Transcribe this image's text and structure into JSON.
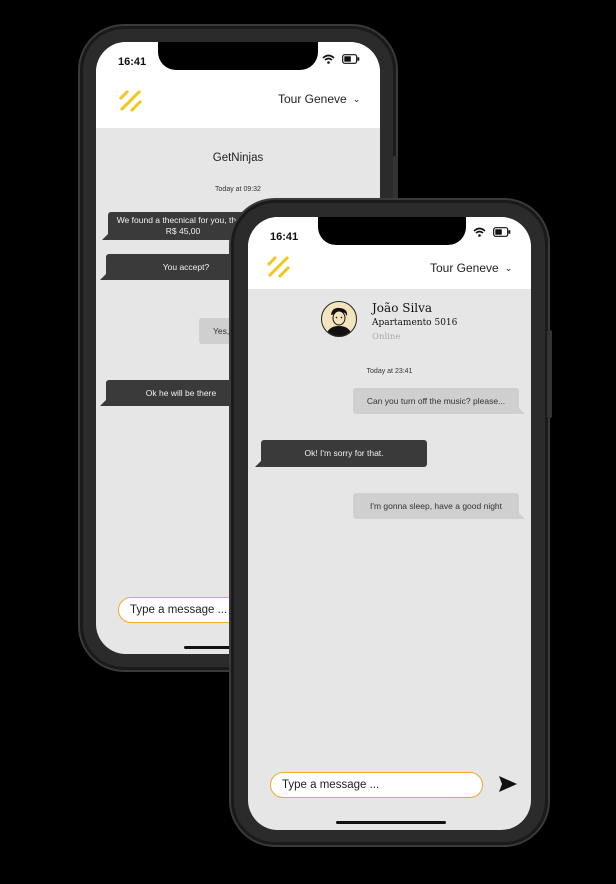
{
  "back_phone": {
    "status_time": "16:41",
    "header": {
      "location": "Tour Geneve"
    },
    "chat_title": "GetNinjas",
    "timestamp": "Today at 09:32",
    "messages": [
      {
        "text": "We found a thecnical for you, the is R$ 45,00",
        "from": "them"
      },
      {
        "text": "You accept?",
        "from": "them"
      },
      {
        "text": "Yes,",
        "from": "me"
      },
      {
        "text": "Ok he will be there",
        "from": "them"
      }
    ],
    "input_placeholder": "Type a message ..."
  },
  "front_phone": {
    "status_time": "16:41",
    "header": {
      "location": "Tour Geneve"
    },
    "contact": {
      "name": "João Silva",
      "unit": "Apartamento 5016",
      "status": "Online"
    },
    "timestamp": "Today at 23:41",
    "messages": [
      {
        "text": "Can you turn off the music? please...",
        "from": "me"
      },
      {
        "text": "Ok! I'm sorry for that.",
        "from": "them"
      },
      {
        "text": "I'm gonna sleep, have a good night",
        "from": "me"
      }
    ],
    "input_placeholder": "Type a message ...",
    "send_icon": "send-icon"
  },
  "colors": {
    "accent": "#f5c518",
    "input_border": "#f2a92a",
    "dark_bubble": "#3a3a3a",
    "light_bubble": "#cfcfcf"
  }
}
